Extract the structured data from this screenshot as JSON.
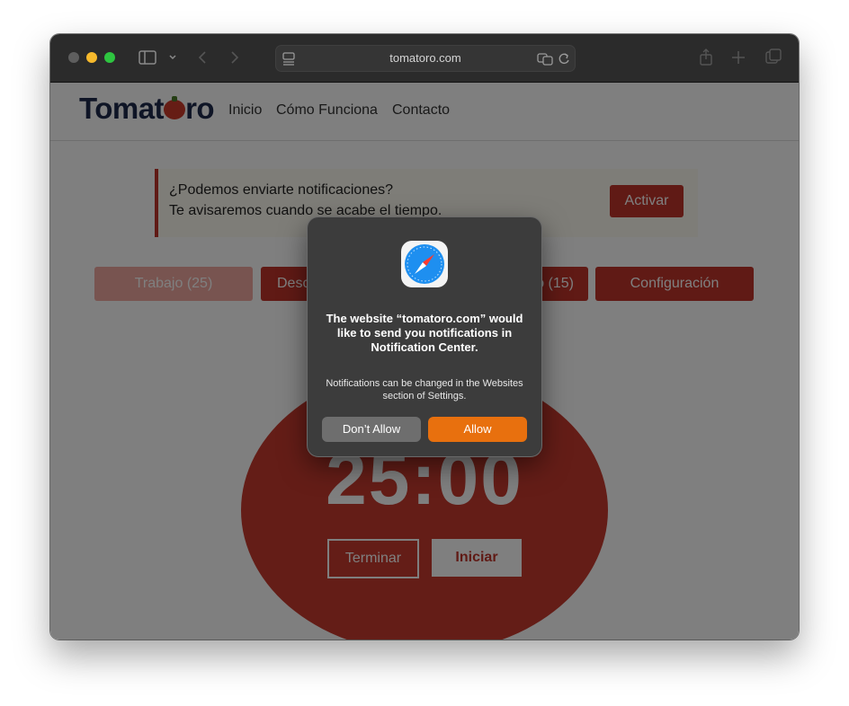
{
  "browser": {
    "url": "tomatoro.com",
    "icons": [
      "sidebar-icon",
      "chevron-down-icon",
      "back-icon",
      "forward-icon",
      "page-menu-icon",
      "translate-icon",
      "reload-icon",
      "share-icon",
      "new-tab-icon",
      "tab-overview-icon"
    ]
  },
  "site": {
    "logo": {
      "part1": "Tomat",
      "part2": "ro"
    },
    "nav": [
      "Inicio",
      "Cómo Funciona",
      "Contacto"
    ],
    "banner": {
      "line1": "¿Podemos enviarte notificaciones?",
      "line2": "Te avisaremos cuando se acabe el tiempo.",
      "button": "Activar"
    },
    "tabs": [
      "Trabajo (25)",
      "Desc",
      "o (15)",
      "Configuración"
    ],
    "timer": "25:00",
    "stop_button": "Terminar",
    "start_button": "Iniciar"
  },
  "dialog": {
    "title": "The website “tomatoro.com” would like to send you notifications in Notification Center.",
    "subtitle": "Notifications can be changed in the Websites section of Settings.",
    "deny": "Don’t Allow",
    "allow": "Allow"
  },
  "colors": {
    "brand_red": "#c1352a",
    "allow_orange": "#e8700e",
    "deny_gray": "#6e6e6e"
  }
}
